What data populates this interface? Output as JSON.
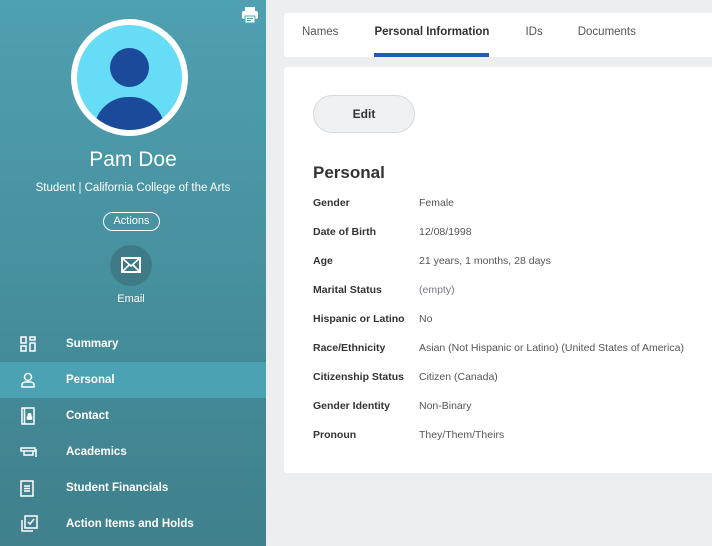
{
  "profile": {
    "name": "Pam Doe",
    "subtitle": "Student | California College of the Arts",
    "actions_label": "Actions",
    "email_label": "Email"
  },
  "nav": [
    {
      "label": "Summary",
      "icon": "dashboard-icon"
    },
    {
      "label": "Personal",
      "icon": "person-icon"
    },
    {
      "label": "Contact",
      "icon": "contact-book-icon"
    },
    {
      "label": "Academics",
      "icon": "graduation-cap-icon"
    },
    {
      "label": "Student Financials",
      "icon": "document-list-icon"
    },
    {
      "label": "Action Items and Holds",
      "icon": "checklist-icon"
    }
  ],
  "tabs": [
    "Names",
    "Personal Information",
    "IDs",
    "Documents"
  ],
  "main": {
    "edit_label": "Edit",
    "section_title": "Personal",
    "fields": [
      {
        "label": "Gender",
        "value": "Female"
      },
      {
        "label": "Date of Birth",
        "value": "12/08/1998"
      },
      {
        "label": "Age",
        "value": "21 years, 1 months, 28 days"
      },
      {
        "label": "Marital Status",
        "value": "(empty)"
      },
      {
        "label": "Hispanic or Latino",
        "value": "No"
      },
      {
        "label": "Race/Ethnicity",
        "value": "Asian (Not Hispanic or Latino) (United States of America)"
      },
      {
        "label": "Citizenship Status",
        "value": "Citizen (Canada)"
      },
      {
        "label": "Gender Identity",
        "value": "Non-Binary"
      },
      {
        "label": "Pronoun",
        "value": "They/Them/Theirs"
      }
    ]
  },
  "colors": {
    "accent": "#1f5bb5",
    "sidebar": "#4899a9",
    "active": "#4aa2b3"
  }
}
